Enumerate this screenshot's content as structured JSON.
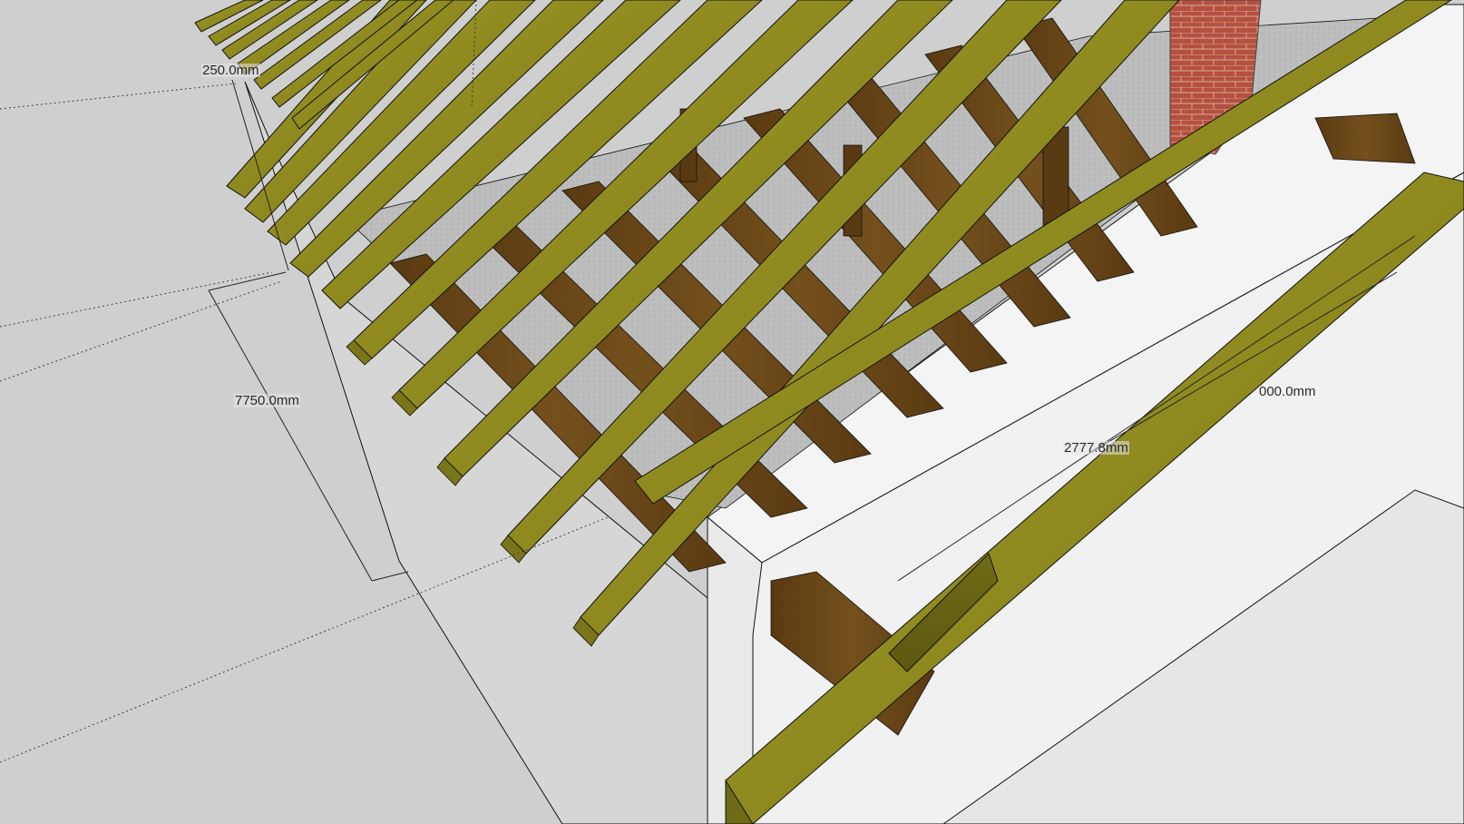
{
  "viewport": {
    "background_color": "#cfcfcf",
    "colors": {
      "ground": "#cfcfcf",
      "wall_white": "#f2f2f2",
      "wall_shade": "#dcdcdc",
      "floor_grey": "#bdbdbd",
      "rafter_wood": "#8f8a1f",
      "rafter_wood_light": "#a8a22e",
      "rafter_wood_dark": "#6f6a14",
      "joist_wood_dark": "#5a3a12",
      "joist_wood_mid": "#74501c",
      "brick_red": "#b5503f",
      "edge_line": "#111111"
    }
  },
  "dimensions": {
    "plate_height": "250.0mm",
    "span": "7750.0mm",
    "rafter_length": "2777.8mm",
    "ridge_offset": "000.0mm"
  }
}
